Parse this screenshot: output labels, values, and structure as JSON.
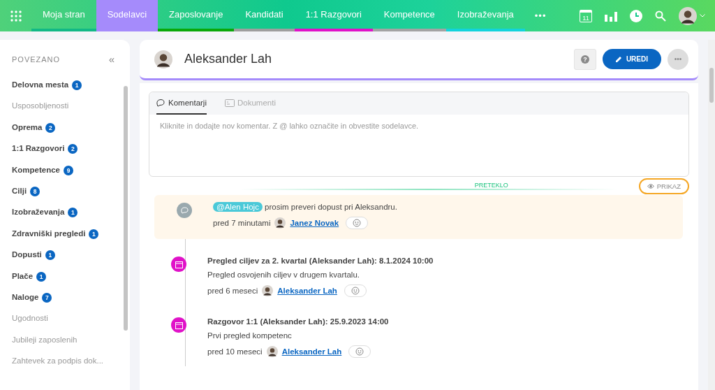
{
  "nav": {
    "items": [
      {
        "label": "Moja stran",
        "selected": false,
        "color": "#12b886"
      },
      {
        "label": "Sodelavci",
        "selected": true,
        "color": "#a58bfb"
      },
      {
        "label": "Zaposlovanje",
        "selected": false,
        "color": "#0aa80a"
      },
      {
        "label": "Kandidati",
        "selected": false,
        "color": "#9e9e9e"
      },
      {
        "label": "1:1 Razgovori",
        "selected": false,
        "color": "#e012c8"
      },
      {
        "label": "Kompetence",
        "selected": false,
        "color": "#a3a3a3"
      },
      {
        "label": "Izobraževanja",
        "selected": false,
        "color": "#12d3dc"
      }
    ],
    "more": "•••",
    "calendar_day": "11"
  },
  "sidebar": {
    "title": "POVEZANO",
    "collapse": "«",
    "items": [
      {
        "label": "Delovna mesta",
        "count": "1",
        "disabled": false
      },
      {
        "label": "Usposobljenosti",
        "disabled": true
      },
      {
        "label": "Oprema",
        "count": "2",
        "disabled": false
      },
      {
        "label": "1:1 Razgovori",
        "count": "2",
        "disabled": false
      },
      {
        "label": "Kompetence",
        "count": "9",
        "disabled": false
      },
      {
        "label": "Cilji",
        "count": "8",
        "disabled": false
      },
      {
        "label": "Izobraževanja",
        "count": "1",
        "disabled": false
      },
      {
        "label": "Zdravniški pregledi",
        "count": "1",
        "disabled": false
      },
      {
        "label": "Dopusti",
        "count": "1",
        "disabled": false
      },
      {
        "label": "Plače",
        "count": "1",
        "disabled": false
      },
      {
        "label": "Naloge",
        "count": "7",
        "disabled": false
      },
      {
        "label": "Ugodnosti",
        "disabled": true
      },
      {
        "label": "Jubileji zaposlenih",
        "disabled": true
      },
      {
        "label": "Zahtevek za podpis dok...",
        "disabled": true
      }
    ]
  },
  "header": {
    "name": "Aleksander Lah",
    "help": "?",
    "edit_button": "UREDI",
    "more": "•••"
  },
  "tabs": [
    {
      "label": "Komentarji",
      "selected": true
    },
    {
      "label": "Dokumenti",
      "selected": false
    }
  ],
  "comment_field": {
    "placeholder": "Kliknite in dodajte nov komentar. Z @ lahko označite in obvestite sodelavce."
  },
  "divider_label": "PRETEKLO",
  "view_button": "PRIKAZ",
  "timeline": [
    {
      "kind": "comment",
      "mention": "@Alen Hojc",
      "text": "prosim preveri dopust pri Aleksandru.",
      "time": "pred 7 minutami",
      "author": "Janez Novak"
    },
    {
      "kind": "event",
      "title": "Pregled ciljev za 2. kvartal (Aleksander Lah): 8.1.2024 10:00",
      "text": "Pregled osvojenih ciljev v drugem kvartalu.",
      "time": "pred 6 meseci",
      "author": "Aleksander Lah"
    },
    {
      "kind": "event",
      "title": "Razgovor 1:1 (Aleksander Lah): 25.9.2023 14:00",
      "text": "Prvi pregled kompetenc",
      "time": "pred 10 meseci",
      "author": "Aleksander Lah"
    }
  ]
}
